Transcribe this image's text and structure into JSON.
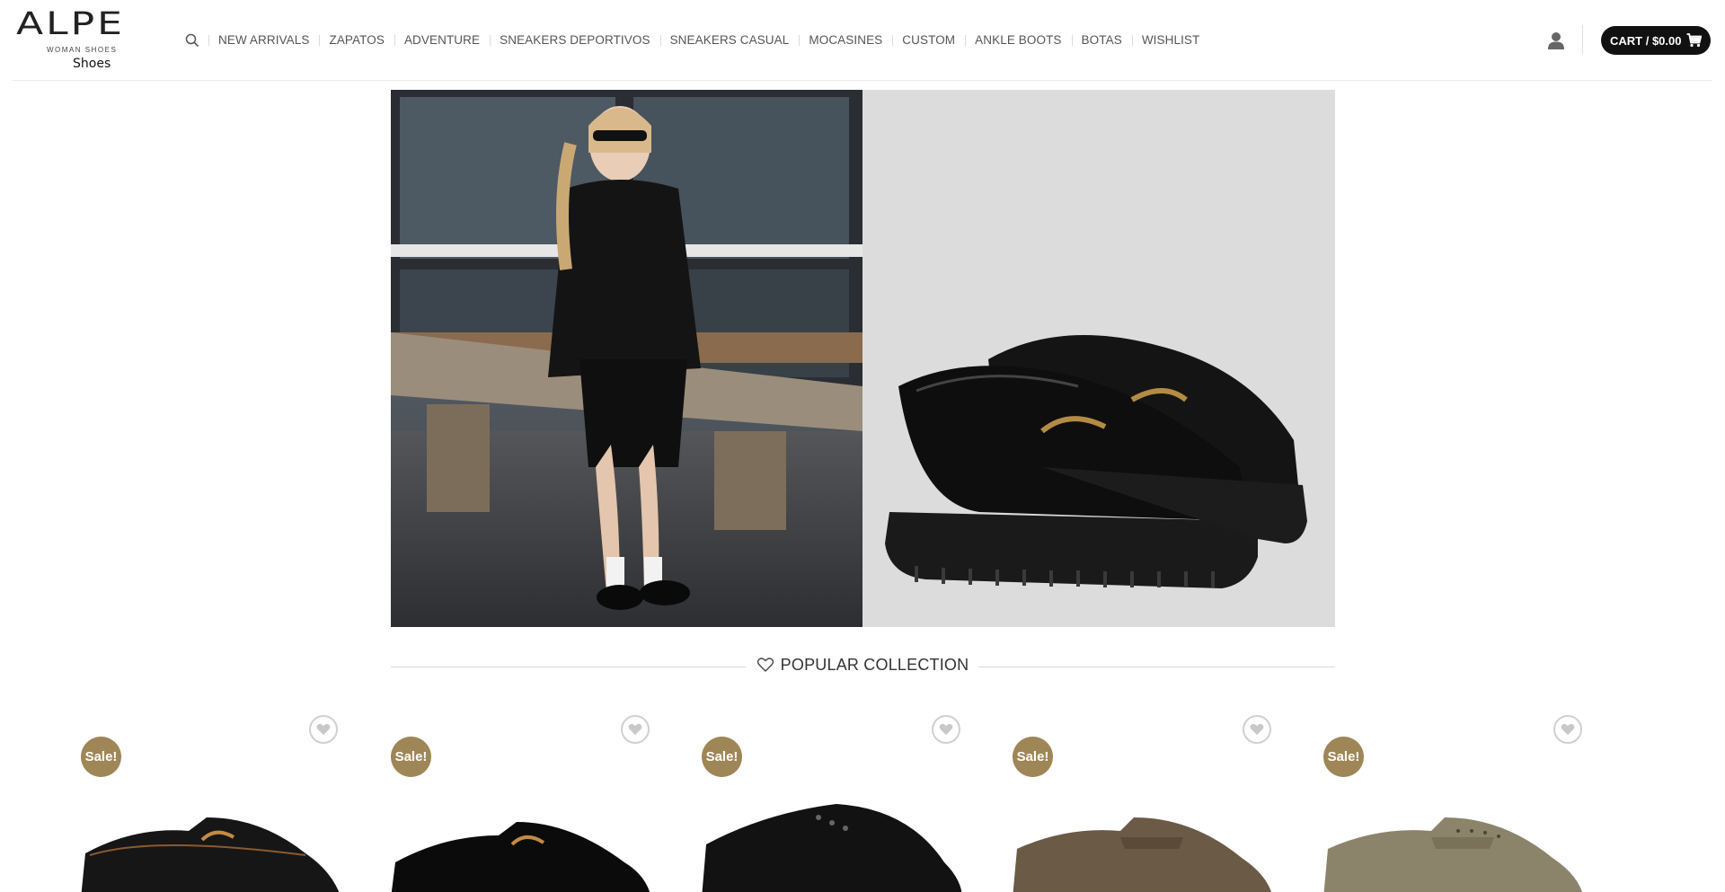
{
  "brand": {
    "logo_text": "ALPE",
    "logo_subtext": "WOMAN SHOES",
    "caption": "Shoes"
  },
  "nav": {
    "search_icon": "search-icon",
    "items": [
      {
        "label": "NEW ARRIVALS"
      },
      {
        "label": "ZAPATOS"
      },
      {
        "label": "ADVENTURE"
      },
      {
        "label": "SNEAKERS DEPORTIVOS"
      },
      {
        "label": "SNEAKERS CASUAL"
      },
      {
        "label": "MOCASINES"
      },
      {
        "label": "CUSTOM"
      },
      {
        "label": "ANKLE BOOTS"
      },
      {
        "label": "BOTAS"
      },
      {
        "label": "WISHLIST"
      }
    ]
  },
  "header_right": {
    "account_icon": "user-icon",
    "cart_label": "CART / $0.00",
    "cart_icon": "cart-icon"
  },
  "hero": {
    "left_image": "woman-on-bench-photo",
    "right_image": "black-horsebit-loafers-photo"
  },
  "section": {
    "icon": "heart-outline-icon",
    "title": "POPULAR COLLECTION"
  },
  "products": [
    {
      "badge": "Sale!",
      "wishlist_icon": "heart-icon",
      "image": "black-horsebit-loafer"
    },
    {
      "badge": "Sale!",
      "wishlist_icon": "heart-icon",
      "image": "black-suede-horsebit-loafer"
    },
    {
      "badge": "Sale!",
      "wishlist_icon": "heart-icon",
      "image": "black-patent-derby"
    },
    {
      "badge": "Sale!",
      "wishlist_icon": "heart-icon",
      "image": "brown-suede-penny-loafer"
    },
    {
      "badge": "Sale!",
      "wishlist_icon": "heart-icon",
      "image": "taupe-studded-penny-loafer"
    }
  ],
  "colors": {
    "accent_badge": "#9e8656",
    "cart_bg": "#111111",
    "text": "#555555"
  }
}
